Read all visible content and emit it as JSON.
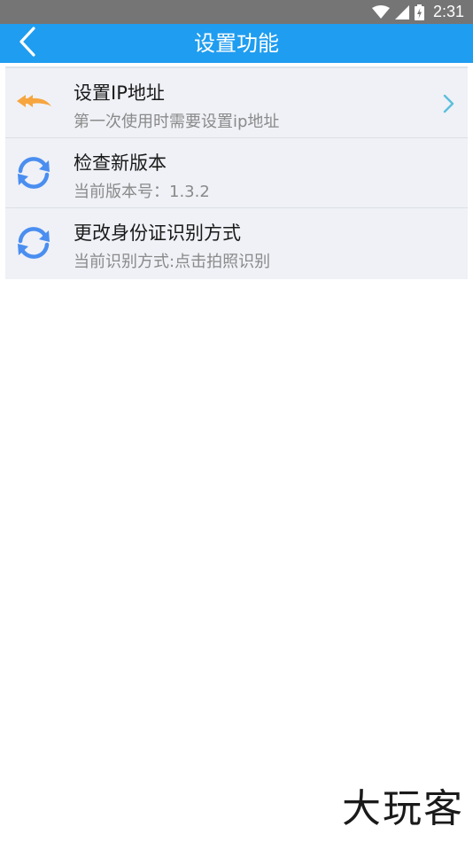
{
  "status_bar": {
    "time": "2:31",
    "icons": [
      "wifi-icon",
      "signal-icon",
      "battery-charging-icon"
    ]
  },
  "header": {
    "title": "设置功能",
    "back_icon": "chevron-left-icon",
    "background_color": "#1f9df0"
  },
  "settings": {
    "items": [
      {
        "title": "设置IP地址",
        "subtitle": "第一次使用时需要设置ip地址",
        "icon": "double-arrow-back-icon",
        "icon_color": "#f7a53e",
        "has_chevron": true
      },
      {
        "title": "检查新版本",
        "subtitle": "当前版本号：1.3.2",
        "icon": "refresh-icon",
        "icon_color": "#4a8ef0",
        "has_chevron": false
      },
      {
        "title": "更改身份证识别方式",
        "subtitle": "当前识别方式:点击拍照识别",
        "icon": "refresh-icon",
        "icon_color": "#4a8ef0",
        "has_chevron": false
      }
    ]
  },
  "watermark": {
    "text": "大玩客"
  }
}
